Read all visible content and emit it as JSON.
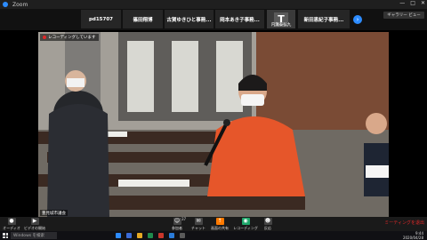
{
  "window": {
    "title": "Zoom",
    "controls": [
      "—",
      "□",
      "✕"
    ]
  },
  "participants_strip": {
    "tiles": [
      {
        "label": "pd15707"
      },
      {
        "label": "篠田翔博"
      },
      {
        "label": "古賀ゆきひと事務..."
      },
      {
        "label": "岡本あき子事務..."
      },
      {
        "label": "T",
        "sub": "内灘泰弘九"
      },
      {
        "label": "新田恵紀子事務..."
      }
    ],
    "next_icon": "›",
    "view_button": "ギャラリー ビュー"
  },
  "main_video": {
    "recording_banner": "レコーディングしています",
    "speaker_name": "豊見城市議会"
  },
  "toolbar": {
    "items": [
      {
        "key": "audio",
        "label": "オーディオ",
        "icon": "mic-icon"
      },
      {
        "key": "video",
        "label": "ビデオの開始",
        "icon": "camera-icon"
      },
      {
        "key": "participants",
        "label": "参加者",
        "icon": "people-icon",
        "badge": "37"
      },
      {
        "key": "chat",
        "label": "チャット",
        "icon": "chat-icon"
      },
      {
        "key": "share",
        "label": "画面の共有",
        "icon": "share-icon"
      },
      {
        "key": "record",
        "label": "レコーディング",
        "icon": "record-icon"
      },
      {
        "key": "reactions",
        "label": "反応",
        "icon": "smile-icon"
      }
    ],
    "end_label": "ミーティングを退出"
  },
  "taskbar": {
    "search_placeholder": "Windows を検索",
    "time": "9:44",
    "date": "2020/04/28"
  },
  "colors": {
    "accent": "#2d8cff",
    "danger": "#e02828",
    "share": "#ff7a00",
    "record": "#1fa86b"
  }
}
